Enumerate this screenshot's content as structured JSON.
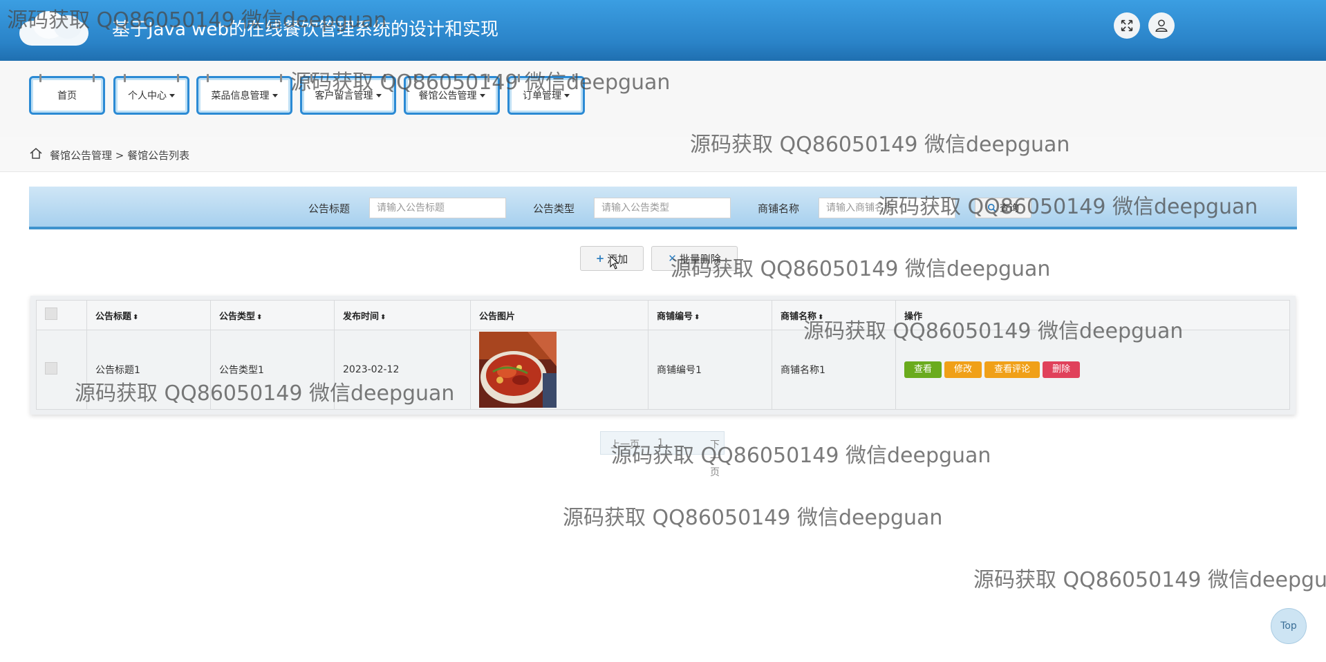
{
  "header": {
    "title": "基于Java web的在线餐饮管理系统的设计和实现",
    "fullscreen_icon": "expand-icon",
    "user_icon": "user-icon",
    "bg_color": "#2a83c8"
  },
  "nav": {
    "items": [
      {
        "label": "首页",
        "has_dropdown": false
      },
      {
        "label": "个人中心",
        "has_dropdown": true
      },
      {
        "label": "菜品信息管理",
        "has_dropdown": true
      },
      {
        "label": "客户留言管理",
        "has_dropdown": true
      },
      {
        "label": "餐馆公告管理",
        "has_dropdown": true
      },
      {
        "label": "订单管理",
        "has_dropdown": true
      }
    ]
  },
  "breadcrumb": {
    "text": "餐馆公告管理 > 餐馆公告列表",
    "icon": "home-icon"
  },
  "search": {
    "title_label": "公告标题",
    "title_placeholder": "请输入公告标题",
    "type_label": "公告类型",
    "type_placeholder": "请输入公告类型",
    "shop_label": "商铺名称",
    "shop_placeholder": "请输入商铺名称",
    "query_label": "查询"
  },
  "actions": {
    "add_label": "添加",
    "batch_delete_label": "批量删除"
  },
  "table": {
    "columns": [
      "公告标题",
      "公告类型",
      "发布时间",
      "公告图片",
      "商铺编号",
      "商铺名称",
      "操作"
    ],
    "rows": [
      {
        "title": "公告标题1",
        "type": "公告类型1",
        "date": "2023-02-12",
        "shop_no": "商铺编号1",
        "shop_name": "商铺名称1"
      }
    ],
    "row_buttons": {
      "view": "查看",
      "edit": "修改",
      "comments": "查看评论",
      "delete": "删除"
    },
    "button_colors": {
      "view": "#6aab1d",
      "edit": "#f0a018",
      "comments": "#f0a018",
      "delete": "#e0415b"
    }
  },
  "pagination": {
    "prev": "上一页",
    "current": "1",
    "next": "下一页"
  },
  "watermark": "源码获取 QQ86050149 微信deepguan",
  "top_button": "Top"
}
